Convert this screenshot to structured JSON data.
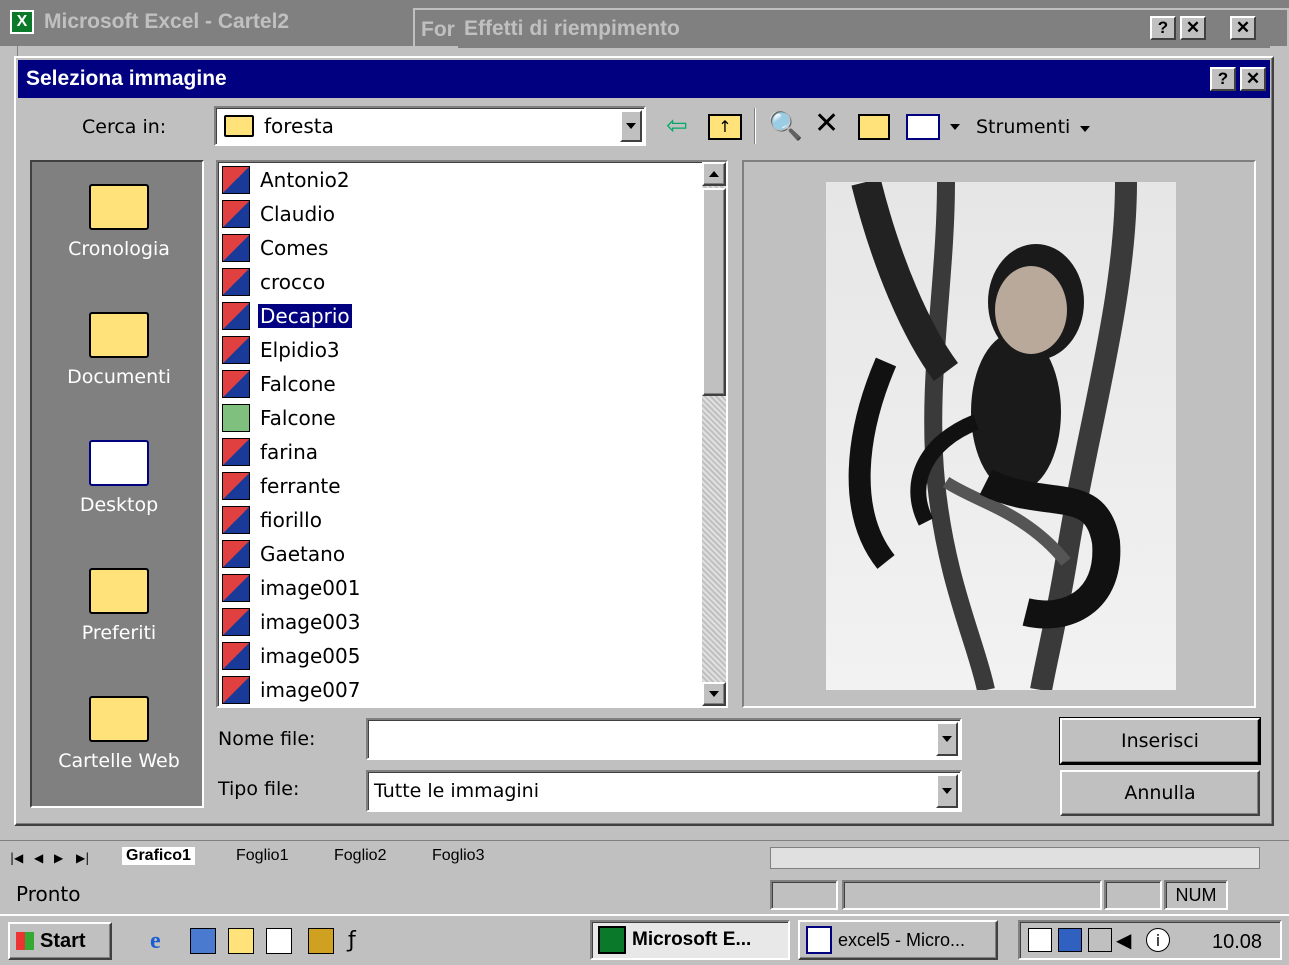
{
  "excel_window": {
    "title": "Microsoft Excel - Cartel2"
  },
  "format_dialog": {
    "title_prefix": "For"
  },
  "fill_effects_dialog": {
    "title": "Effetti di riempimento",
    "help": "?",
    "close": "✕"
  },
  "dialog": {
    "title": "Seleziona immagine",
    "help": "?",
    "close": "✕",
    "look_in_label": "Cerca in:",
    "look_in_value": "foresta",
    "tools_label": "Strumenti",
    "places": [
      {
        "label": "Cronologia",
        "icon": "history-icon"
      },
      {
        "label": "Documenti",
        "icon": "documents-icon"
      },
      {
        "label": "Desktop",
        "icon": "desktop-icon"
      },
      {
        "label": "Preferiti",
        "icon": "favorites-icon"
      },
      {
        "label": "Cartelle Web",
        "icon": "web-folders-icon"
      }
    ],
    "files": [
      "Antonio2",
      "Claudio",
      "Comes",
      "crocco",
      "Decaprio",
      "Elpidio3",
      "Falcone",
      "Falcone",
      "farina",
      "ferrante",
      "fiorillo",
      "Gaetano",
      "image001",
      "image003",
      "image005",
      "image007"
    ],
    "selected_file": "Decaprio",
    "file_name_label": "Nome file:",
    "file_name_value": "",
    "file_type_label": "Tipo file:",
    "file_type_value": "Tutte le immagini",
    "insert_button": "Inserisci",
    "cancel_button": "Annulla"
  },
  "sheet_tabs": [
    "Grafico1",
    "Foglio1",
    "Foglio2",
    "Foglio3"
  ],
  "status_bar": {
    "text": "Pronto",
    "num": "NUM"
  },
  "taskbar": {
    "start": "Start",
    "tasks": [
      "Microsoft E...",
      "excel5 - Micro..."
    ],
    "clock": "10.08"
  }
}
